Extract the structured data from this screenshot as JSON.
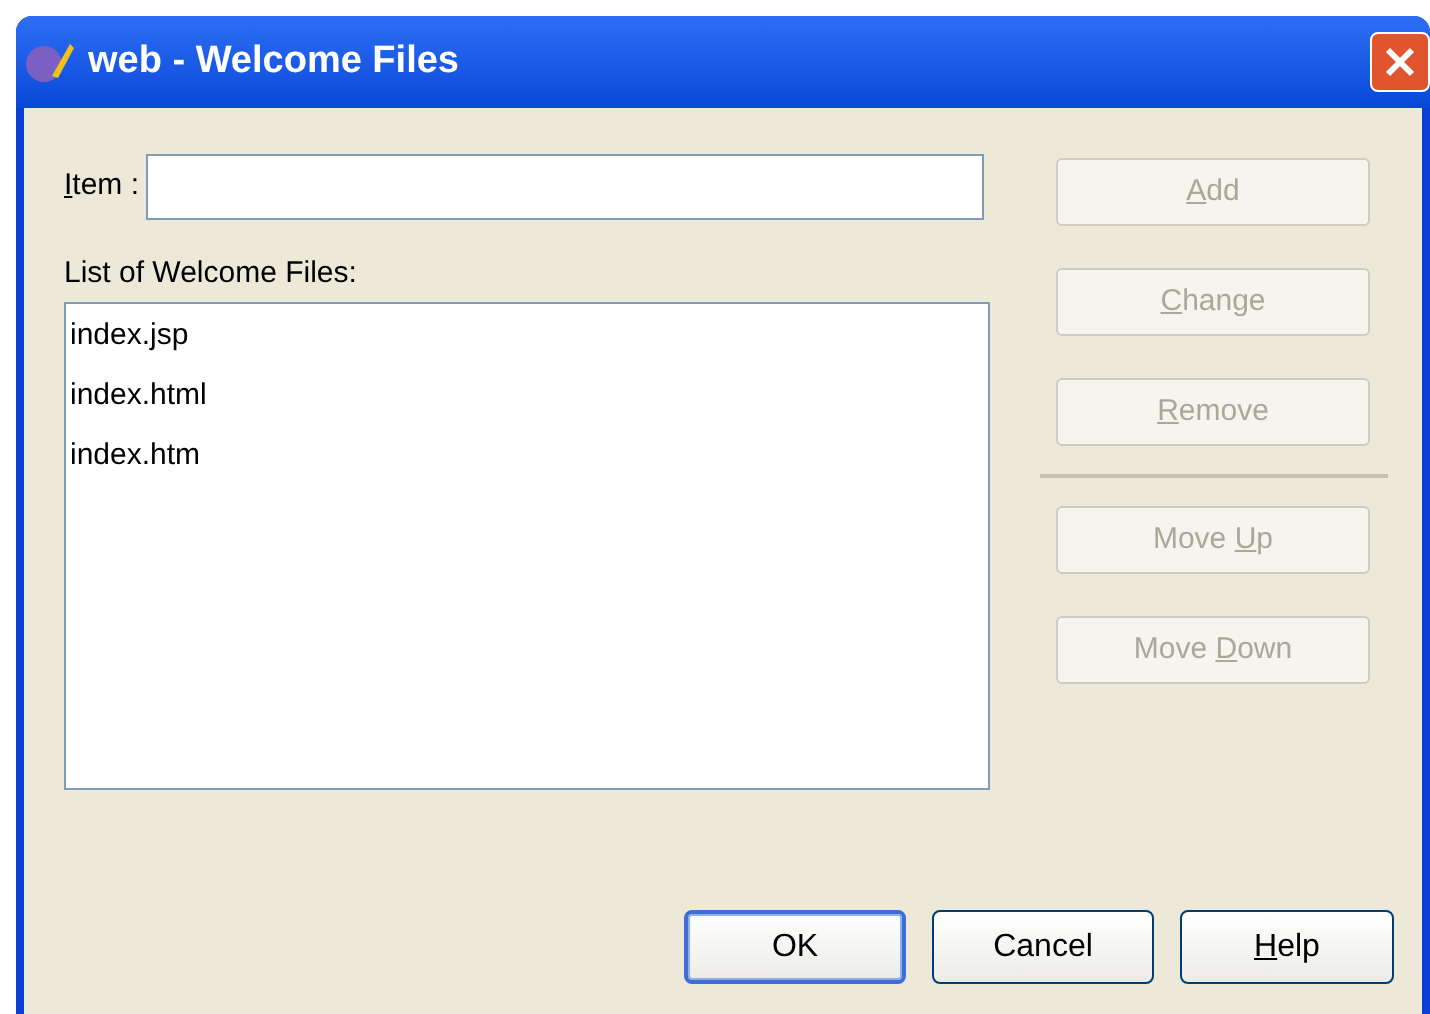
{
  "window": {
    "title": "web - Welcome Files"
  },
  "item_field": {
    "label": {
      "mnemonic": "I",
      "after": "tem :"
    }
  },
  "list": {
    "label": "List of Welcome Files:",
    "items": [
      {
        "text": "index.jsp",
        "selected": false
      },
      {
        "text": "index.html",
        "selected": false
      },
      {
        "text": "index.htm",
        "selected": false
      }
    ]
  },
  "side_buttons": [
    {
      "label": {
        "mnemonic": "A",
        "after": "dd"
      },
      "disabled": true
    },
    {
      "label": {
        "mnemonic": "C",
        "after": "hange"
      },
      "disabled": true
    },
    {
      "label": {
        "mnemonic": "R",
        "after": "emove"
      },
      "disabled": true
    },
    {
      "label": {
        "before": "Move ",
        "mnemonic": "U",
        "after": "p"
      },
      "disabled": true
    },
    {
      "label": {
        "before": "Move ",
        "mnemonic": "D",
        "after": "own"
      },
      "disabled": true
    }
  ],
  "footer_buttons": [
    {
      "label": {
        "before": "OK"
      },
      "default": true
    },
    {
      "label": {
        "before": "Cancel"
      },
      "default": false
    },
    {
      "label": {
        "mnemonic": "H",
        "after": "elp"
      },
      "default": false
    }
  ]
}
